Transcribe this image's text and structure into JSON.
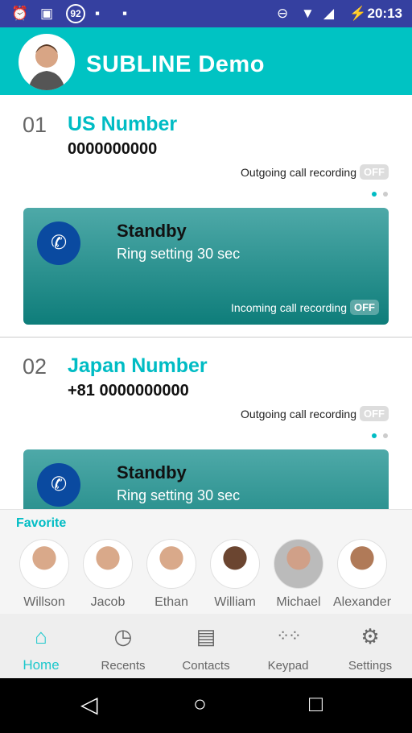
{
  "status_bar": {
    "time": "20:13",
    "notification_badge": "92",
    "icons": [
      "alarm-icon",
      "image-icon",
      "badge-92-icon",
      "android-icon",
      "android-icon",
      "dnd-icon",
      "wifi-icon",
      "signal-icon",
      "battery-charging-icon"
    ]
  },
  "header": {
    "title": "SUBLINE Demo"
  },
  "lines": [
    {
      "index": "01",
      "name": "US Number",
      "number": "0000000000",
      "outgoing_label": "Outgoing call recording",
      "outgoing_state": "OFF",
      "status": "Standby",
      "ring": "Ring setting 30 sec",
      "incoming_label": "Incoming call recording",
      "incoming_state": "OFF"
    },
    {
      "index": "02",
      "name": "Japan Number",
      "number": "+81 0000000000",
      "outgoing_label": "Outgoing call recording",
      "outgoing_state": "OFF",
      "status": "Standby",
      "ring": "Ring setting 30 sec"
    }
  ],
  "favorites": {
    "label": "Favorite",
    "contacts": [
      "Willson",
      "Jacob",
      "Ethan",
      "William",
      "Michael",
      "Alexander"
    ]
  },
  "nav": {
    "items": [
      {
        "label": "Home",
        "icon": "home-icon"
      },
      {
        "label": "Recents",
        "icon": "clock-icon"
      },
      {
        "label": "Contacts",
        "icon": "contacts-book-icon"
      },
      {
        "label": "Keypad",
        "icon": "keypad-icon"
      },
      {
        "label": "Settings",
        "icon": "gear-icon"
      }
    ],
    "active": "Home"
  },
  "colors": {
    "accent": "#00c3c3",
    "status_bar": "#3540a0",
    "card": "#0e7d7a",
    "call_icon": "#0a4aa0"
  }
}
